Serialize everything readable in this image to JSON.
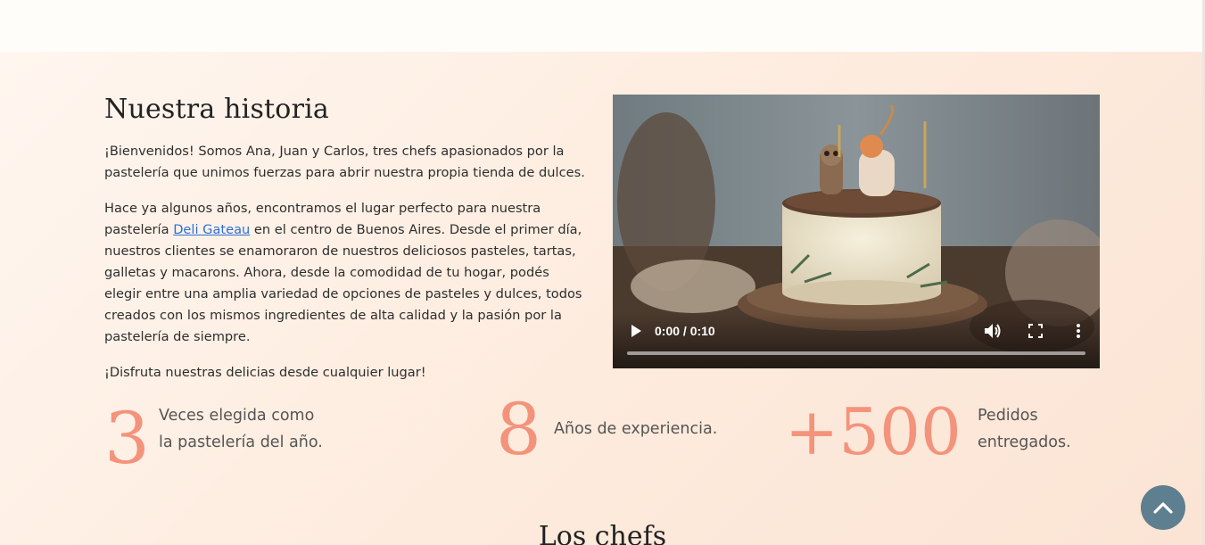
{
  "history": {
    "title": "Nuestra historia",
    "p1": "¡Bienvenidos! Somos Ana, Juan y Carlos, tres chefs apasionados por la pastelería que unimos fuerzas para abrir nuestra propia tienda de dulces.",
    "p2_before": "Hace ya algunos años, encontramos el lugar perfecto para nuestra pastelería ",
    "p2_link": "Deli Gateau",
    "p2_after": " en el centro de Buenos Aires. Desde el primer día, nuestros clientes se enamoraron de nuestros deliciosos pasteles, tartas, galletas y macarons. Ahora, desde la comodidad de tu hogar, podés elegir entre una amplia variedad de opciones de pasteles y dulces, todos creados con los mismos ingredientes de alta calidad y la pasión por la pastelería de siempre.",
    "p3": "¡Disfruta nuestras delicias desde cualquier lugar!"
  },
  "video": {
    "time": "0:00 / 0:10",
    "progress": 0,
    "icons": [
      "play-icon",
      "volume-icon",
      "fullscreen-icon",
      "more-options-icon"
    ]
  },
  "stats": [
    {
      "number": "3",
      "label_line1": "Veces elegida como",
      "label_line2": "la pastelería del año."
    },
    {
      "number": "8",
      "label_line1": "Años de experiencia.",
      "label_line2": ""
    },
    {
      "number": "+500",
      "label_line1": "Pedidos",
      "label_line2": "entregados."
    }
  ],
  "chefs": {
    "title": "Los chefs"
  },
  "colors": {
    "accent": "#f4937b",
    "scroll_button": "#5e7f8f",
    "link": "#2a6fd6"
  },
  "scroll_top": {
    "icon": "chevron-up-icon"
  }
}
